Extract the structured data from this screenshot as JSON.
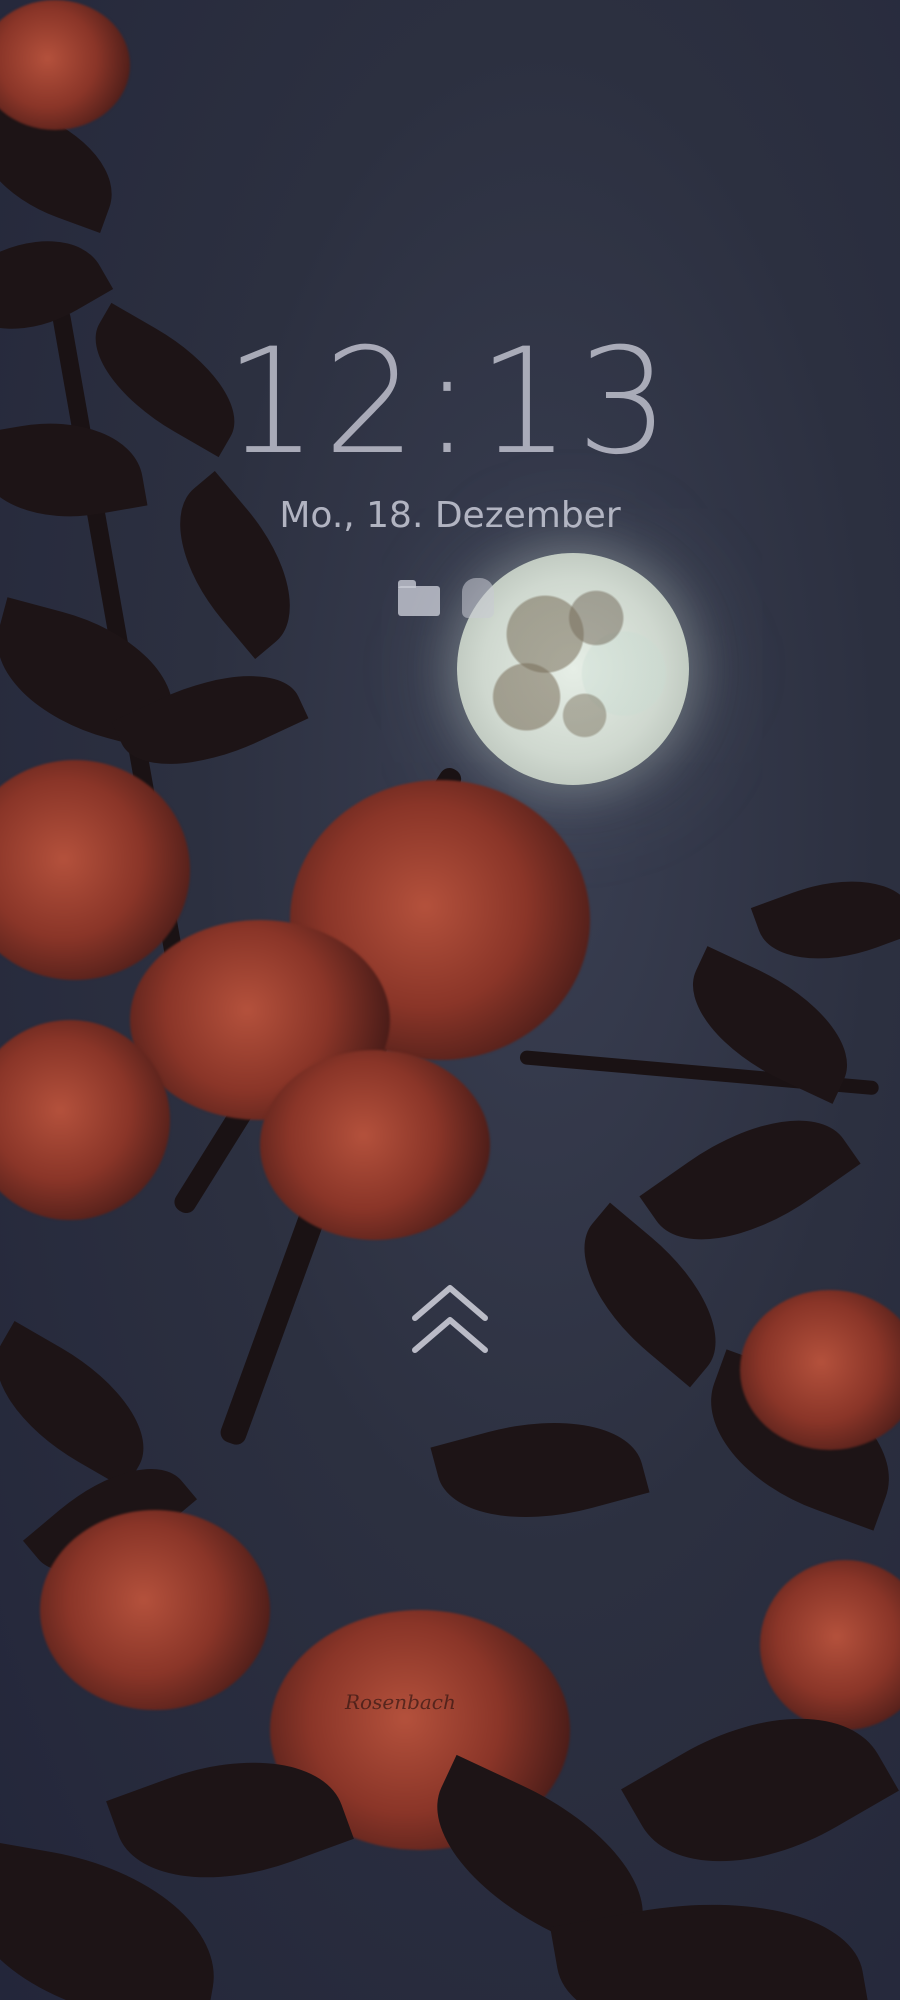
{
  "lockscreen": {
    "time": "12:13",
    "date": "Mo., 18. Dezember",
    "notification_icons": [
      "folder-icon",
      "app-icon"
    ],
    "unlock_hint_icon": "double-chevron-up-icon"
  },
  "wallpaper": {
    "watermark": "Rosenbach",
    "colors": {
      "sky": "#2c3040",
      "moon": "#dfe8df",
      "blossom": "#a8493a",
      "leaf": "#1d1416"
    }
  }
}
